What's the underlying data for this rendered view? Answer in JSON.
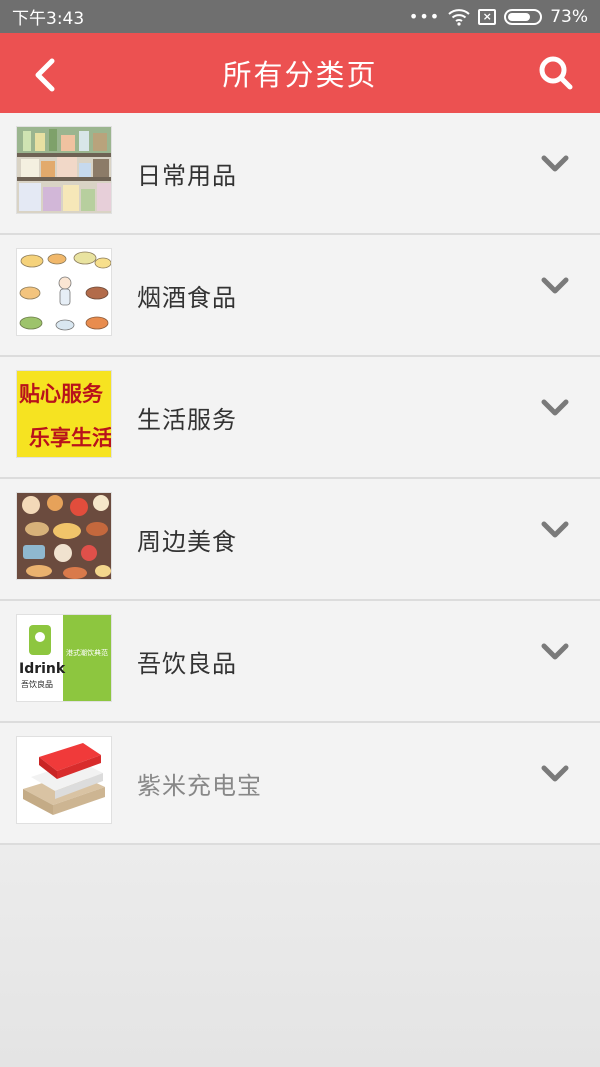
{
  "status_bar": {
    "time": "下午3:43",
    "dots": "•••",
    "battery_percent": "73%",
    "battery_level": 0.73
  },
  "header": {
    "title": "所有分类页",
    "back_icon": "chevron-left-icon",
    "search_icon": "search-icon",
    "accent_color": "#ec5151"
  },
  "categories": [
    {
      "label": "日常用品",
      "thumbnail": "shelf-goods"
    },
    {
      "label": "烟酒食品",
      "thumbnail": "food-sketch"
    },
    {
      "label": "生活服务",
      "thumbnail": "service-banner",
      "banner_line1": "贴心服务",
      "banner_line2": "乐享生活"
    },
    {
      "label": "周边美食",
      "thumbnail": "food-illustration"
    },
    {
      "label": "吾饮良品",
      "thumbnail": "idrink-logo",
      "logo_text": "Idrink",
      "logo_sub": "吾饮良品",
      "slogan": "港式潮饮典范"
    },
    {
      "label": "紫米充电宝",
      "thumbnail": "power-bank"
    }
  ]
}
